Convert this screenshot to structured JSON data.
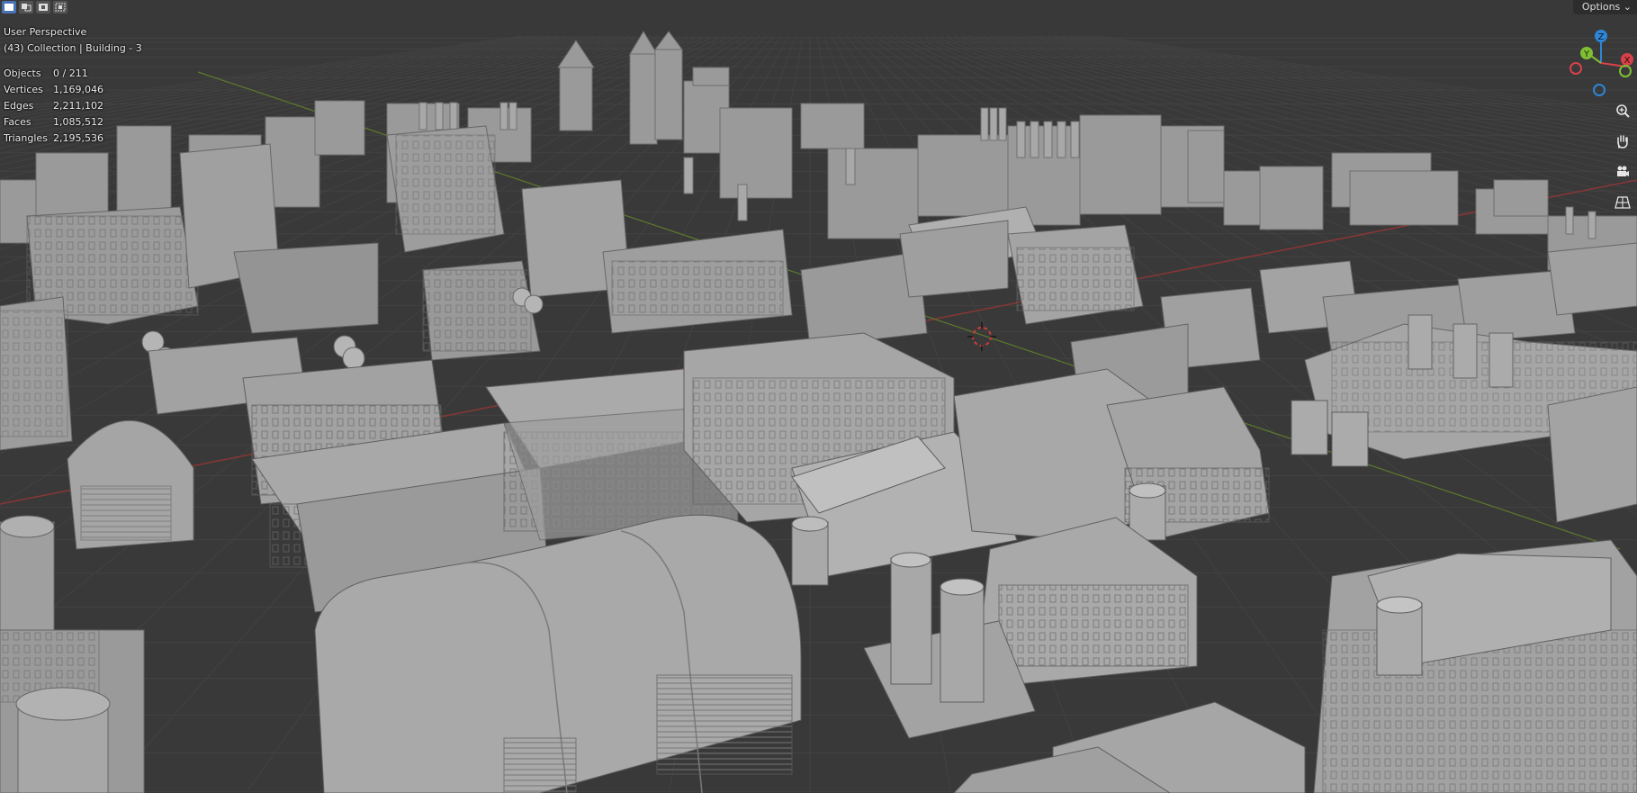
{
  "viewport": {
    "perspective_label": "User Perspective",
    "collection_label": "(43) Collection | Building - 3",
    "stats": [
      {
        "key": "Objects",
        "value": "0 / 211"
      },
      {
        "key": "Vertices",
        "value": "1,169,046"
      },
      {
        "key": "Edges",
        "value": "2,211,102"
      },
      {
        "key": "Faces",
        "value": "1,085,512"
      },
      {
        "key": "Triangles",
        "value": "2,195,536"
      }
    ]
  },
  "header": {
    "options_label": "Options",
    "selection_modes": [
      "select-new-icon",
      "extend-selection-icon",
      "subtract-selection-icon",
      "intersect-selection-icon"
    ]
  },
  "gizmo": {
    "axes": [
      {
        "label": "Z",
        "color": "#2f86d6"
      },
      {
        "label": "Y",
        "color": "#7fbf33"
      },
      {
        "label": "X",
        "color": "#d9414a"
      }
    ]
  },
  "navigation": [
    "zoom-icon",
    "pan-hand-icon",
    "camera-icon",
    "perspective-grid-icon"
  ],
  "colors": {
    "background": "#3a3a3a",
    "grid_line": "#424242",
    "x_axis_line": "#8a3636",
    "y_axis_line": "#5d7a2c",
    "building_light": "#a3a3a3",
    "building_mid": "#8c8c8c",
    "building_dark": "#6e6e6e"
  }
}
